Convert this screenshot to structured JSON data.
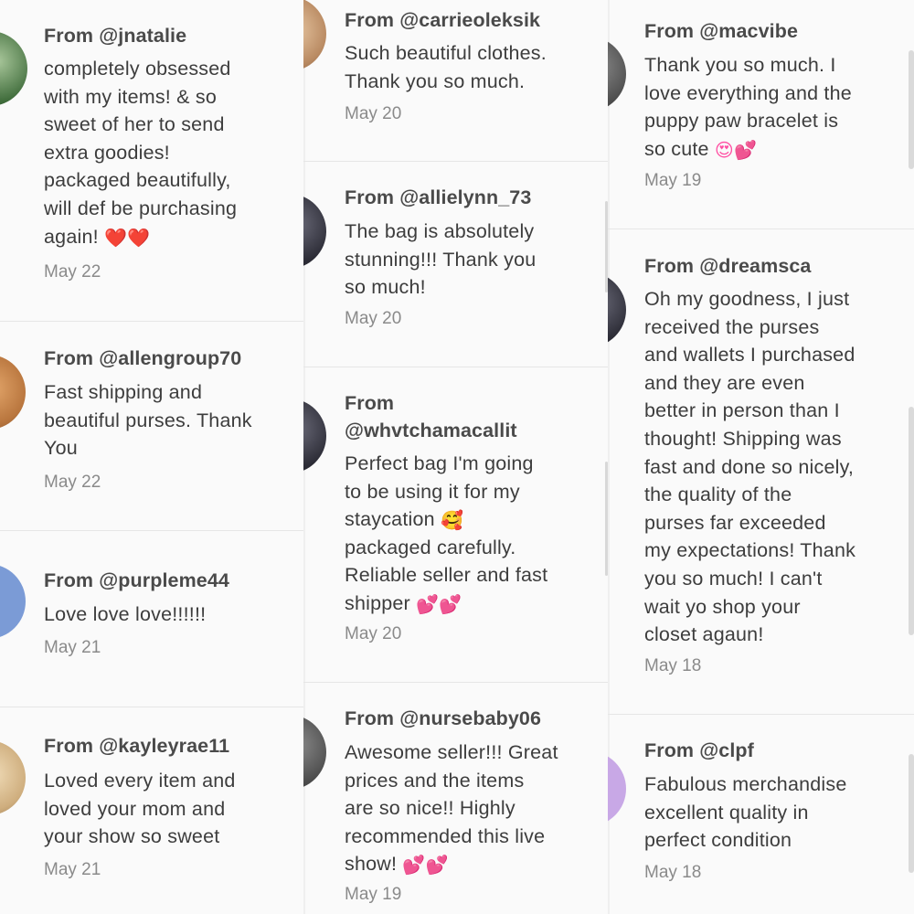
{
  "columns": [
    {
      "cards": [
        {
          "from": "From @jnatalie",
          "message": "completely obsessed\nwith my items! & so\nsweet of her to send\nextra goodies!\npackaged beautifully,\nwill def be purchasing\nagain!",
          "emoji": "❤️❤️",
          "date": "May 22"
        },
        {
          "from": "From @allengroup70",
          "message": "Fast shipping and\nbeautiful purses. Thank\nYou",
          "date": "May 22"
        },
        {
          "from": "From @purpleme44",
          "message": "Love love love!!!!!!",
          "date": "May 21"
        },
        {
          "from": "From @kayleyrae11",
          "message": "Loved every item and\nloved your mom and\nyour show so sweet",
          "date": "May 21"
        }
      ]
    },
    {
      "cards": [
        {
          "from": "From @carrieoleksik",
          "message": "Such beautiful clothes.\nThank you so much.",
          "date": "May 20"
        },
        {
          "from": "From @allielynn_73",
          "message": "The bag is absolutely\nstunning!!! Thank you\nso much!",
          "date": "May 20"
        },
        {
          "from": "From\n@whvtchamacallit",
          "message": "Perfect bag I'm going\nto be using it for my\nstaycation",
          "emoji_inline": "🥰",
          "message_tail": "packaged carefully.\nReliable seller and fast\nshipper",
          "emoji": "💕💕",
          "date": "May 20"
        },
        {
          "from": "From @nursebaby06",
          "message": "Awesome seller!!! Great\nprices and the items\nare so nice!! Highly\nrecommended this live\nshow!",
          "emoji": "💕💕",
          "date": "May 19"
        }
      ]
    },
    {
      "cards": [
        {
          "from": "From @macvibe",
          "message": "Thank you so much. I\nlove everything and the\npuppy paw bracelet is\nso cute",
          "emoji": "😍💕",
          "date": "May 19"
        },
        {
          "from": "From @dreamsca",
          "message": "Oh my goodness, I just\nreceived the purses\nand wallets I purchased\nand they are even\nbetter in person than I\nthought! Shipping was\nfast and done so nicely,\nthe quality of the\npurses far exceeded\nmy expectations! Thank\nyou so much! I can't\nwait yo shop your\ncloset agaun!",
          "date": "May 18"
        },
        {
          "from": "From @clpf",
          "message": "Fabulous merchandise\nexcellent quality in\nperfect condition",
          "date": "May 18"
        }
      ]
    }
  ],
  "colors": {
    "background": "#fafafa",
    "divider": "#e6e6e6",
    "username": "#4a4a4a",
    "text": "#3d3d3d",
    "date": "#8a8a8a"
  },
  "icons": [
    "avatar",
    "heart-emoji",
    "smiling-face-with-hearts-emoji",
    "two-hearts-emoji",
    "heart-eyes-emoji"
  ]
}
